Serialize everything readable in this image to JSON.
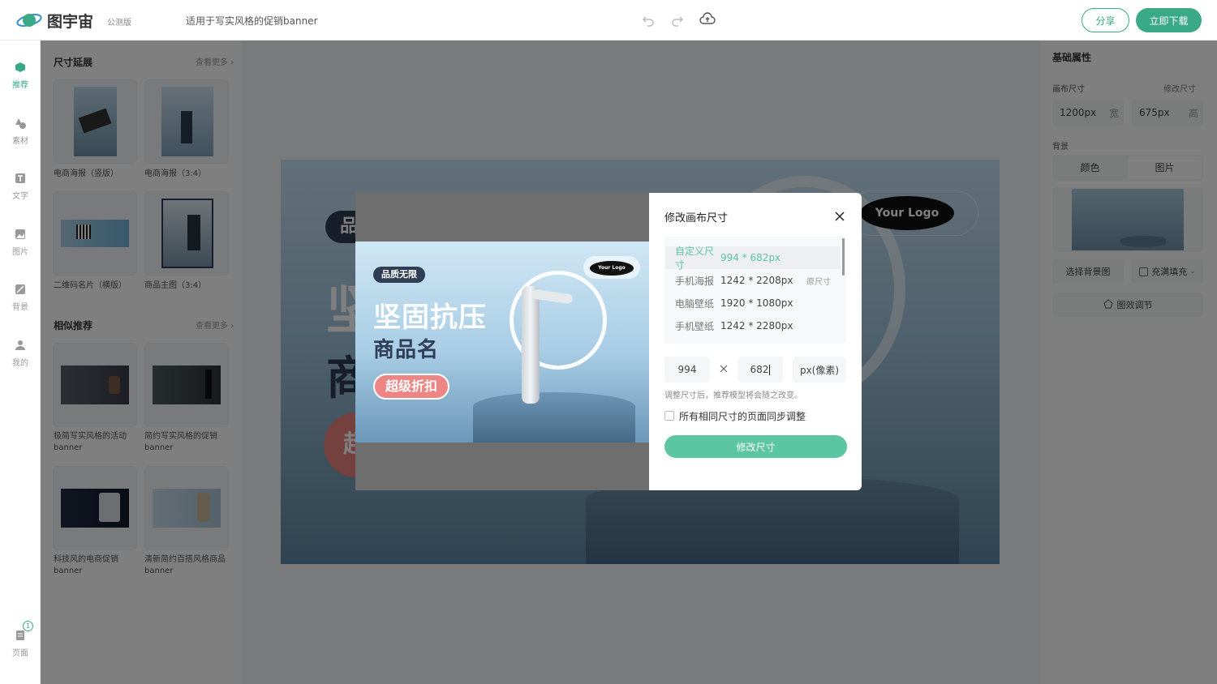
{
  "header": {
    "brand": "图宇宙",
    "beta": "公测版",
    "doc_title": "适用于写实风格的促销banner",
    "share_label": "分享",
    "download_label": "立即下载"
  },
  "nav": {
    "items": [
      {
        "label": "推荐"
      },
      {
        "label": "素材"
      },
      {
        "label": "文字"
      },
      {
        "label": "图片"
      },
      {
        "label": "背景"
      },
      {
        "label": "我的"
      }
    ],
    "pages_label": "页面",
    "pages_count": "1"
  },
  "left_panel": {
    "size_section": {
      "title": "尺寸延展",
      "more": "查看更多",
      "items": [
        {
          "caption": "电商海报（竖版）"
        },
        {
          "caption": "电商海报（3:4）"
        },
        {
          "caption": "二维码名片（横版）"
        },
        {
          "caption": "商品主图（3:4）"
        }
      ]
    },
    "similar_section": {
      "title": "相似推荐",
      "more": "查看更多",
      "items": [
        {
          "line1": "极简写实风格的活动",
          "line2": "banner"
        },
        {
          "line1": "简约写实风格的促销",
          "line2": "banner"
        },
        {
          "line1": "科技风的电商促销",
          "line2": "banner"
        },
        {
          "line1": "清新简约百搭风格商品",
          "line2": "banner"
        }
      ]
    }
  },
  "right_panel": {
    "title": "基础属性",
    "canvas_size_label": "画布尺寸",
    "modify_size": "修改尺寸",
    "width_value": "1200px",
    "width_unit": "宽",
    "height_value": "675px",
    "height_unit": "高",
    "bg_label": "背景",
    "tab_color": "颜色",
    "tab_image": "图片",
    "choose_bg": "选择背景图",
    "fill_mode": "充满填充",
    "effect": "图效调节"
  },
  "canvas": {
    "logo_text": "Your Logo",
    "badge_char": "品",
    "big_char1": "坚",
    "big_char2": "商",
    "red_char": "超"
  },
  "preview": {
    "badge": "品质无限",
    "headline": "坚固抗压",
    "subline": "商品名",
    "cta": "超级折扣",
    "logo": "Your Logo"
  },
  "dialog": {
    "title": "修改画布尺寸",
    "options": [
      {
        "name": "自定义尺寸",
        "value": "994 * 682px",
        "tag": ""
      },
      {
        "name": "手机海报",
        "value": "1242 * 2208px",
        "tag": "原尺寸"
      },
      {
        "name": "电脑壁纸",
        "value": "1920 * 1080px",
        "tag": ""
      },
      {
        "name": "手机壁纸",
        "value": "1242 * 2280px",
        "tag": ""
      }
    ],
    "width_input": "994",
    "height_input": "682",
    "unit_label": "px(像素)",
    "hint": "调整尺寸后，推荐模型将会随之改变。",
    "sync_label": "所有相同尺寸的页面同步调整",
    "submit_label": "修改尺寸"
  },
  "colors": {
    "accent": "#5cc5a2",
    "accent_dark": "#3aa985"
  }
}
